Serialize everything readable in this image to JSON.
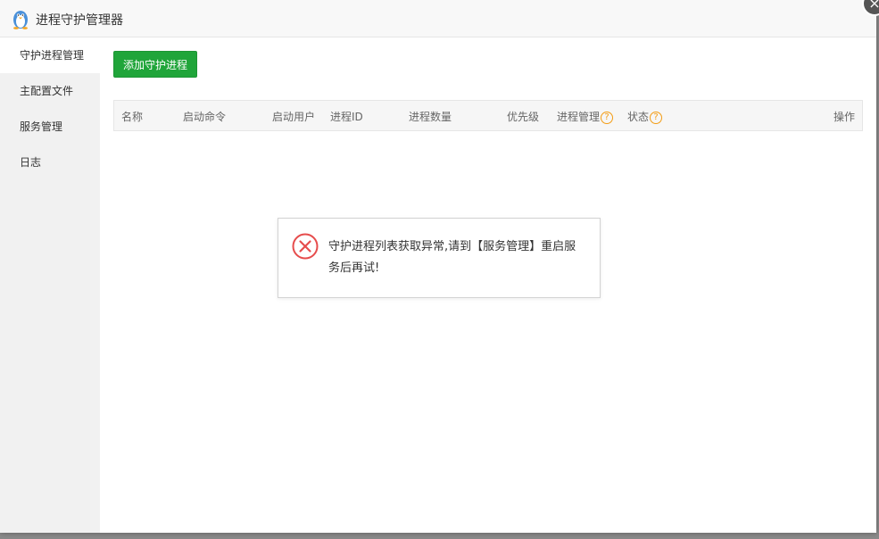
{
  "window": {
    "title": "进程守护管理器",
    "close_icon": "×"
  },
  "sidebar": {
    "items": [
      {
        "label": "守护进程管理",
        "active": true
      },
      {
        "label": "主配置文件",
        "active": false
      },
      {
        "label": "服务管理",
        "active": false
      },
      {
        "label": "日志",
        "active": false
      }
    ]
  },
  "toolbar": {
    "add_label": "添加守护进程"
  },
  "table": {
    "headers": {
      "name": "名称",
      "command": "启动命令",
      "user": "启动用户",
      "pid": "进程ID",
      "count": "进程数量",
      "priority": "优先级",
      "manage": "进程管理",
      "status": "状态",
      "actions": "操作"
    },
    "help_icon": "?"
  },
  "error": {
    "message": "守护进程列表获取异常,请到【服务管理】重启服务后再试!"
  },
  "colors": {
    "accent": "#20a53a",
    "error": "#e64c4c",
    "help": "#f39c12"
  }
}
